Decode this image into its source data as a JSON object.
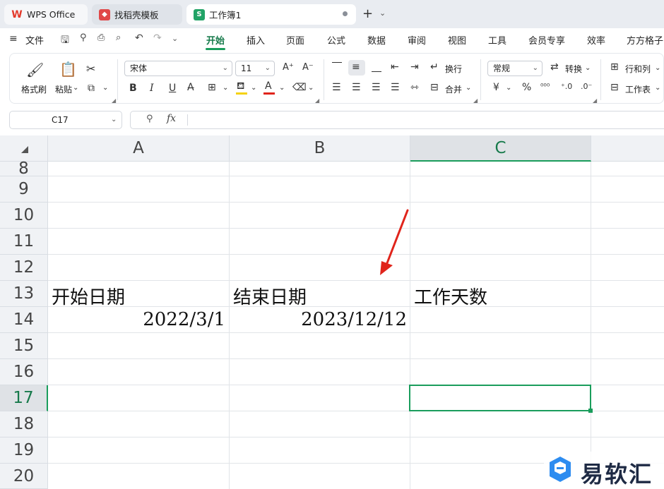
{
  "tabs": [
    {
      "label": "WPS Office",
      "icon": "wps-logo-icon"
    },
    {
      "label": "找稻壳模板",
      "icon": "daoke-icon"
    },
    {
      "label": "工作簿1",
      "icon": "spreadsheet-icon",
      "icon_glyph": "S",
      "active": true
    }
  ],
  "menu": {
    "file": "文件",
    "items": [
      "开始",
      "插入",
      "页面",
      "公式",
      "数据",
      "审阅",
      "视图",
      "工具",
      "会员专享",
      "效率",
      "方方格子"
    ],
    "active": "开始"
  },
  "ribbon": {
    "format_painter": "格式刷",
    "paste": "粘贴",
    "font_name": "宋体",
    "font_size": "11",
    "wrap": "换行",
    "merge": "合并",
    "number_format": "常规",
    "convert": "转换",
    "row_col": "行和列",
    "worksheet": "工作表",
    "bold": "B",
    "italic": "I",
    "underline": "U",
    "currency": "¥",
    "percent": "%"
  },
  "formula_bar": {
    "name_box": "C17",
    "fx": "fx",
    "content": ""
  },
  "sheet": {
    "columns": [
      "A",
      "B",
      "C"
    ],
    "selected_column": "C",
    "rows": [
      "8",
      "9",
      "10",
      "11",
      "12",
      "13",
      "14",
      "15",
      "16",
      "17",
      "18",
      "19",
      "20"
    ],
    "selected_row": "17",
    "cells": {
      "A13": "开始日期",
      "B13": "结束日期",
      "C13": "工作天数",
      "A14": "2022/3/1",
      "B14": "2023/12/12"
    },
    "active_cell": "C17"
  },
  "colors": {
    "accent_green": "#1a9d5c",
    "arrow_red": "#e0241b"
  },
  "watermark": {
    "text": "易软汇"
  }
}
